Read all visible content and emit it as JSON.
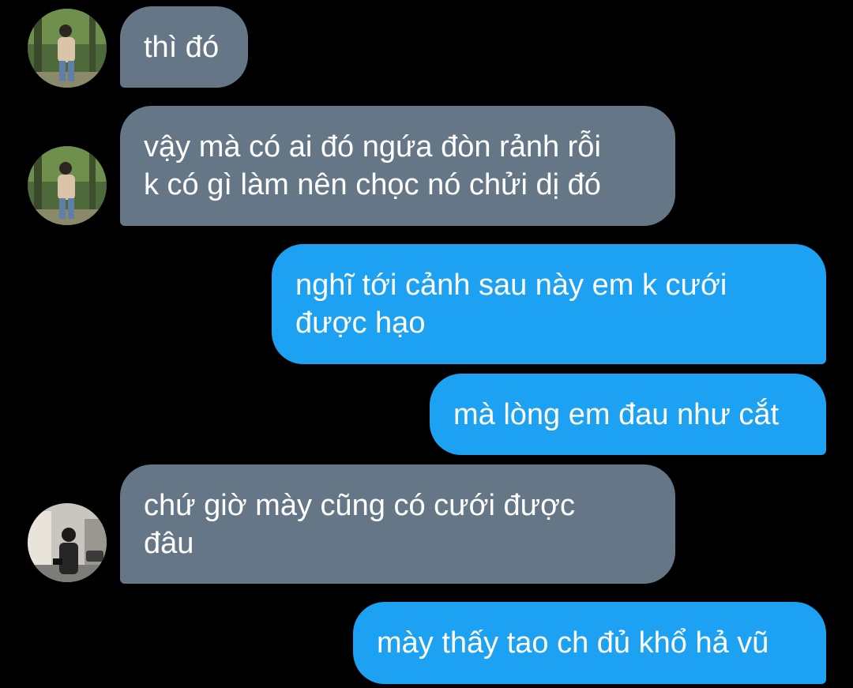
{
  "colors": {
    "background": "#000000",
    "incoming_bubble": "#657786",
    "outgoing_bubble": "#1da1f2",
    "text": "#ffffff"
  },
  "messages": [
    {
      "sender": "other",
      "text": "thì đó"
    },
    {
      "sender": "other",
      "text": "vậy mà có ai đó ngứa đòn rảnh rỗi\nk có gì làm nên chọc nó chửi dị đó"
    },
    {
      "sender": "me",
      "text": "nghĩ tới cảnh sau này em k cưới\nđược hạo"
    },
    {
      "sender": "me",
      "text": "mà lòng em đau như cắt"
    },
    {
      "sender": "other",
      "text": "chứ giờ mày cũng có cưới được\nđâu"
    },
    {
      "sender": "me",
      "text": "mày thấy tao ch đủ khổ hả vũ"
    }
  ]
}
